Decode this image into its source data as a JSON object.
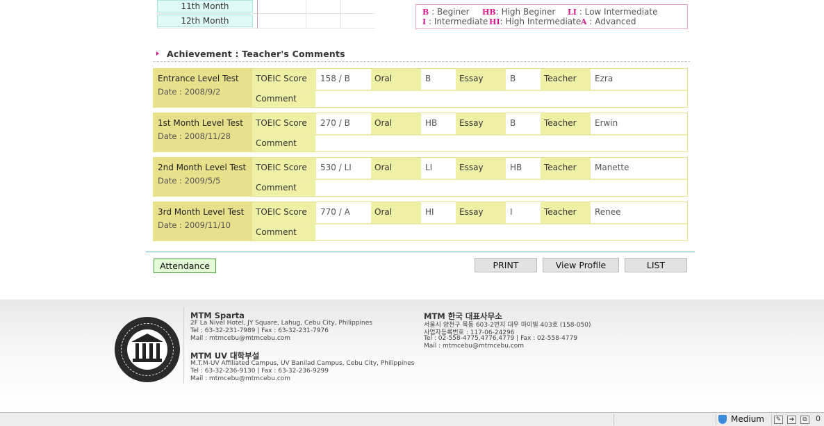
{
  "months": [
    "11th Month",
    "12th Month"
  ],
  "legend": {
    "row1": [
      {
        "abbr": "B",
        "sep": ":",
        "text": "Beginer"
      },
      {
        "abbr": "HB",
        "sep": ":",
        "text": "High Beginer"
      },
      {
        "abbr": "LI",
        "sep": ":",
        "text": "Low Intermediate"
      }
    ],
    "row2": [
      {
        "abbr": "I",
        "sep": ":",
        "text": "Intermediate"
      },
      {
        "abbr": "HI",
        "sep": ":",
        "text": "High Intermediate"
      },
      {
        "abbr": "A",
        "sep": ":",
        "text": "Advanced"
      }
    ]
  },
  "section_title": "Achievement : Teacher's Comments",
  "labels": {
    "toeic": "TOEIC Score",
    "oral": "Oral",
    "essay": "Essay",
    "teacher": "Teacher",
    "comment": "Comment"
  },
  "tests": [
    {
      "name": "Entrance Level Test",
      "date": "Date : 2008/9/2",
      "toeic": "158 / B",
      "oral": "B",
      "essay": "B",
      "teacher": "Ezra",
      "comment": ""
    },
    {
      "name": "1st Month Level Test",
      "date": "Date : 2008/11/28",
      "toeic": "270 / B",
      "oral": "HB",
      "essay": "B",
      "teacher": "Erwin",
      "comment": ""
    },
    {
      "name": "2nd Month Level Test",
      "date": "Date : 2009/5/5",
      "toeic": "530 / LI",
      "oral": "LI",
      "essay": "HB",
      "teacher": "Manette",
      "comment": ""
    },
    {
      "name": "3rd Month Level Test",
      "date": "Date : 2009/11/10",
      "toeic": "770 / A",
      "oral": "HI",
      "essay": "I",
      "teacher": "Renee",
      "comment": ""
    }
  ],
  "buttons": {
    "attendance": "Attendance",
    "print": "PRINT",
    "view_profile": "View Profile",
    "list": "LIST"
  },
  "footer": {
    "sparta": {
      "title": "MTM Sparta",
      "address": "2F La Nivel Hotel, JY Square, Lahug, Cebu City, Philippines",
      "tel": "Tel : 63-32-231-7989 | Fax : 63-32-231-7976",
      "mail": "Mail : mtmcebu@mtmcebu.com"
    },
    "uv": {
      "title": "MTM UV 대학부설",
      "address": "M.T.M-UV Affiliated Campus, UV Banilad Campus, Cebu City, Philippines",
      "tel": "Tel : 63-32-236-9130 | Fax : 63-32-236-9299",
      "mail": "Mail : mtmcebu@mtmcebu.com"
    },
    "korea": {
      "title": "MTM 한국 대표사무소",
      "address": "서울시 양천구 목동 603-2번지 대우 마이빌 403호 (158-050)",
      "biz": "사업자등록번호 : 117-06-24296",
      "tel": "Tel : 02-558-4775,4776,4779  |  Fax : 02-558-4779",
      "mail": "Mail : mtmcebu@mtmcebu.com"
    }
  },
  "statusbar": {
    "zone": "Medium",
    "count": "0"
  },
  "colors": {
    "accent_pink": "#d4198c",
    "header_yellow": "#e8e18c",
    "label_yellow": "#eef0a5",
    "month_cyan": "#dffaf6",
    "divider_teal": "#59b6c6",
    "attendance_green": "#e3fbd6"
  }
}
